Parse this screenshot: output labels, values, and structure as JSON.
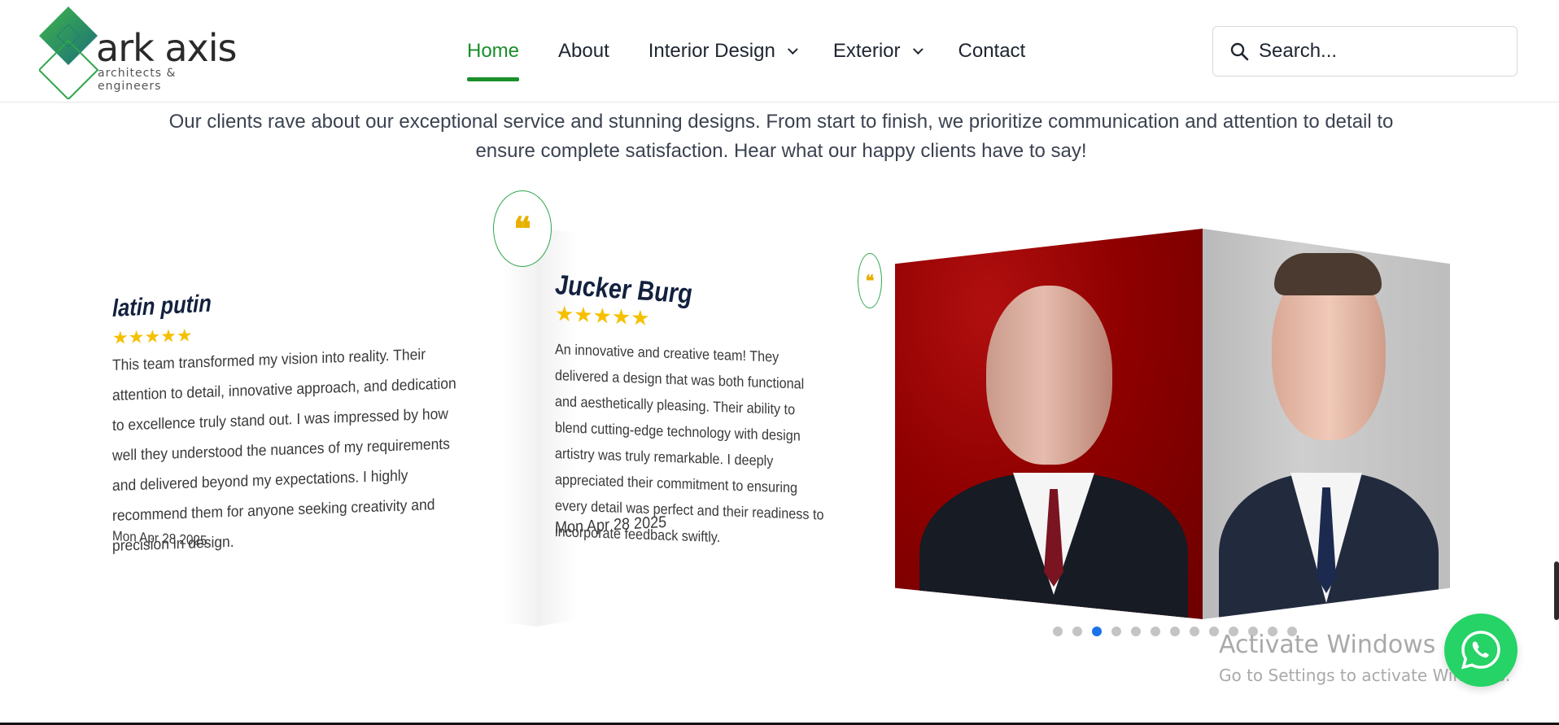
{
  "logo": {
    "word": "ark axis",
    "sub": "architects & engineers",
    "colors": {
      "green": "#2fa64a",
      "teal": "#1f7f7a"
    }
  },
  "nav": {
    "items": [
      {
        "label": "Home",
        "active": true
      },
      {
        "label": "About"
      },
      {
        "label": "Interior Design",
        "dropdown": true
      },
      {
        "label": "Exterior",
        "dropdown": true
      },
      {
        "label": "Contact"
      }
    ]
  },
  "search": {
    "placeholder": "Search..."
  },
  "intro": "Our clients rave about our exceptional service and stunning designs. From start to finish, we prioritize communication and attention to detail to ensure complete satisfaction. Hear what our happy clients have to say!",
  "testimonials": [
    {
      "name": "latin putin",
      "stars": "★★★★★",
      "review": "This team transformed my vision into reality. Their attention to detail, innovative approach, and dedication to excellence truly stand out. I was impressed by how well they understood the nuances of my requirements and delivered beyond my expectations. I highly recommend them for anyone seeking creativity and precision in design.",
      "date": "Mon Apr 28 2025"
    },
    {
      "name": "Jucker Burg",
      "stars": "★★★★★",
      "review": "An innovative and creative team! They delivered a design that was both functional and aesthetically pleasing. Their ability to blend cutting-edge technology with design artistry was truly remarkable. I deeply appreciated their commitment to ensuring every detail was perfect and their readiness to incorporate feedback swiftly.",
      "date": "Mon Apr 28 2025"
    }
  ],
  "quote_glyph": "❝",
  "carousel": {
    "dot_count": 13,
    "active_index": 2
  },
  "watermark": {
    "title": "Activate Windows",
    "subtitle": "Go to Settings to activate Windows."
  },
  "colors": {
    "accent_green": "#1a8f2a",
    "star": "#f5c000",
    "whatsapp": "#25d366",
    "dot_active": "#1a73e8"
  }
}
